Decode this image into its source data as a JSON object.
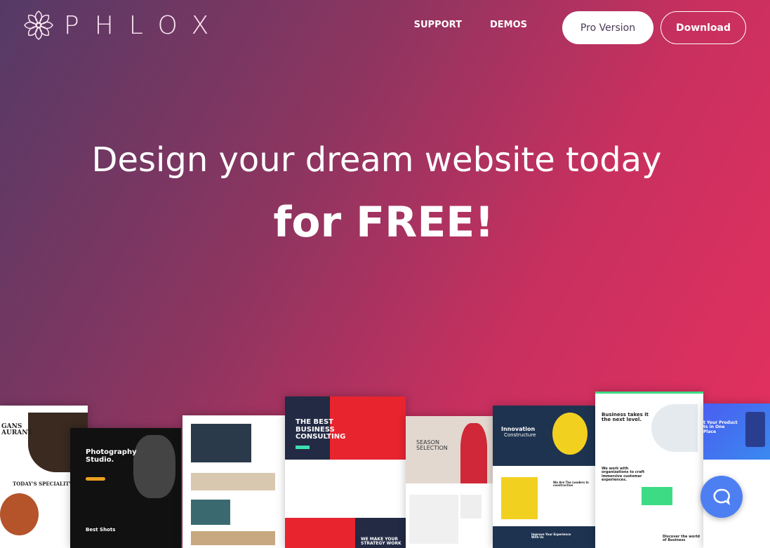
{
  "header": {
    "logo_text": "PHLOX",
    "nav": [
      "SUPPORT",
      "DEMOS"
    ],
    "pro_label": "Pro Version",
    "download_label": "Download"
  },
  "hero": {
    "line1": "Design your dream website today",
    "line2": "for FREE!"
  },
  "previews": {
    "restaurant": {
      "title": "GANS\nAURANT",
      "special": "TODAY'S SPECIALITY"
    },
    "photo": {
      "title": "Photography Studio.",
      "sub": "Best Shots"
    },
    "consulting": {
      "title": "THE BEST BUSINESS CONSULTING",
      "bottom": "WE MAKE YOUR STRATEGY WORK"
    },
    "fashion": {
      "title": "SEASON SELECTION"
    },
    "construction": {
      "title": "Innovation",
      "sub": "Constructure",
      "leaders": "We Are The Leaders In construction",
      "improve": "Improve Your Experience With Us"
    },
    "business": {
      "title": "Business takes it the next level.",
      "body": "We work with organizations to craft immersive customer experiences.",
      "discover": "Discover the world of Business"
    },
    "product": {
      "title": "t Your Product ts in One Place"
    }
  },
  "colors": {
    "accent": "#e8305f",
    "chat": "#4e7ff2"
  },
  "chat": {
    "icon": "chat-bubble-icon"
  }
}
